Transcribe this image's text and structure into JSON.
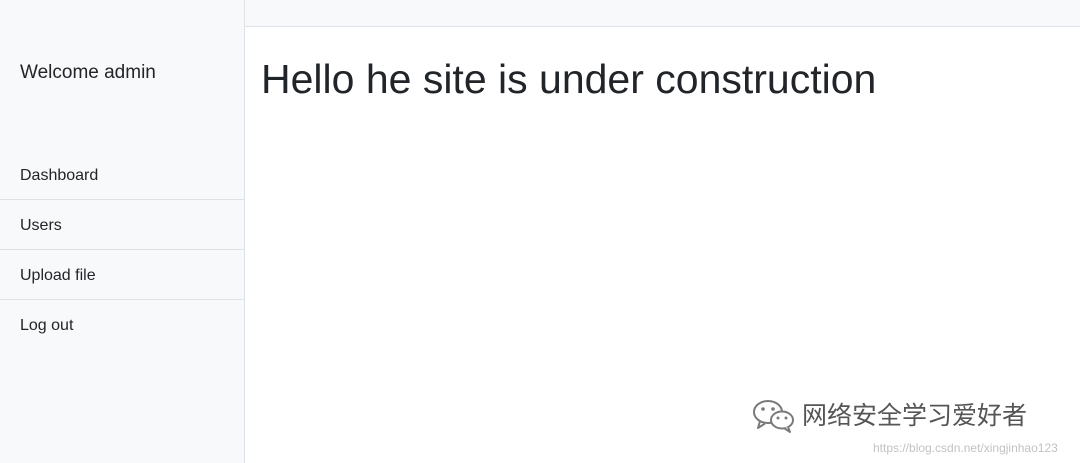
{
  "sidebar": {
    "heading": "Welcome admin",
    "items": [
      {
        "label": "Dashboard"
      },
      {
        "label": "Users"
      },
      {
        "label": "Upload file"
      },
      {
        "label": "Log out"
      }
    ]
  },
  "main": {
    "title": "Hello he site is under construction"
  },
  "watermark": {
    "icon": "wechat-icon",
    "text": "网络安全学习爱好者",
    "url": "https://blog.csdn.net/xingjinhao123"
  },
  "colors": {
    "sidebar_bg": "#f8f9fa",
    "border": "#dee2e6",
    "text": "#212529"
  }
}
